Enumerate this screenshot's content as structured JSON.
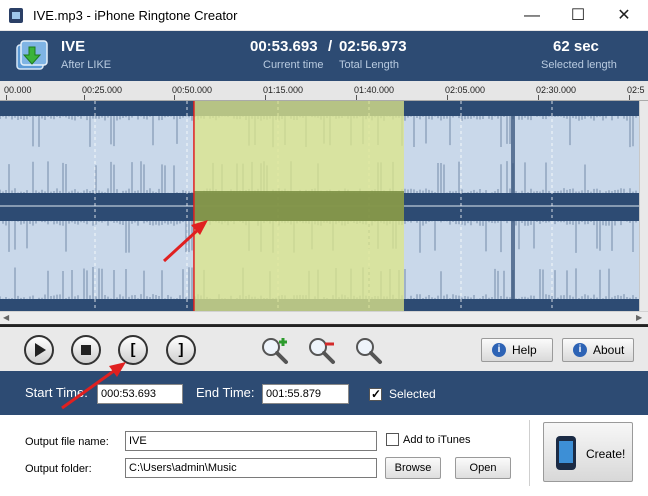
{
  "window": {
    "title": "IVE.mp3 - iPhone Ringtone Creator",
    "minimize": "—",
    "maximize": "☐",
    "close": "✕"
  },
  "info": {
    "track_title": "IVE",
    "track_subtitle": "After LIKE",
    "current_time": "00:53.693",
    "separator": "/",
    "total_length": "02:56.973",
    "current_time_label": "Current time",
    "total_length_label": "Total Length",
    "selected_length": "62 sec",
    "selected_length_label": "Selected length"
  },
  "ruler": {
    "labels": [
      "00.000",
      "00:25.000",
      "00:50.000",
      "01:15.000",
      "01:40.000",
      "02:05.000",
      "02:30.000",
      "02:5"
    ]
  },
  "waveform": {
    "selection_start_fraction": 0.3035,
    "selection_end_fraction": 0.6322,
    "cursor_fraction": 0.3035,
    "background_color": "#2d4b73",
    "wave_color": "#c9d8ea",
    "selection_color": "#dde68a",
    "cursor_color": "#e02020"
  },
  "toolbar": {
    "play_icon": "play-icon",
    "stop_icon": "stop-icon",
    "mark_start": "[",
    "mark_end": "]",
    "zoom_in_icon": "zoom-in-icon",
    "zoom_out_icon": "zoom-out-icon",
    "zoom_fit_icon": "zoom-fit-icon",
    "help_label": "Help",
    "about_label": "About",
    "info_glyph": "i"
  },
  "times": {
    "start_label": "Start Time:",
    "start_value": "000:53.693",
    "end_label": "End Time:",
    "end_value": "001:55.879",
    "selected_label": "Selected",
    "selected_checked": true
  },
  "output": {
    "file_name_label": "Output file name:",
    "file_name_value": "IVE",
    "add_itunes_label": "Add to iTunes",
    "add_itunes_checked": false,
    "folder_label": "Output folder:",
    "folder_value": "C:\\Users\\admin\\Music",
    "browse_label": "Browse",
    "open_label": "Open",
    "create_label": "Create!"
  },
  "colors": {
    "header_bg": "#2d4b73",
    "annotation_arrow": "#e02020"
  }
}
